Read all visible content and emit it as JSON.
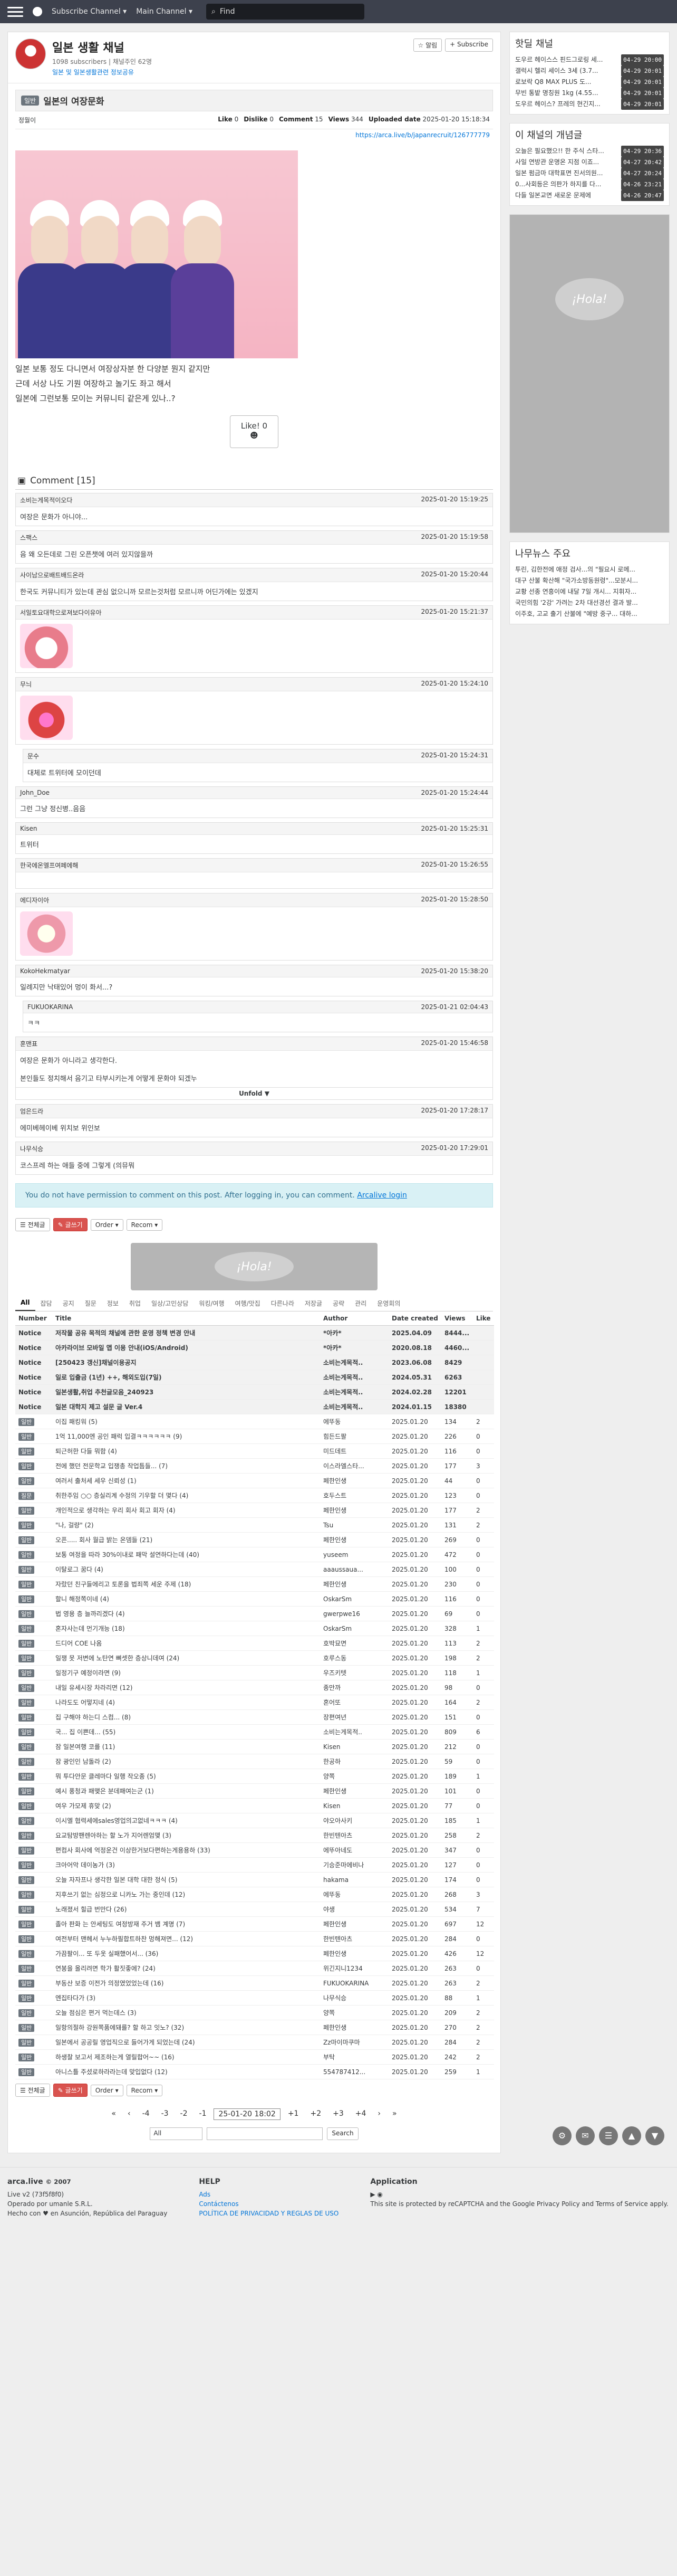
{
  "nav": {
    "brand": "arca.live",
    "menu1": "Subscribe Channel ▾",
    "menu2": "Main Channel ▾",
    "search_placeholder": "Find"
  },
  "channel": {
    "title": "일본 생활 채널",
    "subs": "1098 subscribers",
    "manager": "채널주인 62명",
    "desc": "일본 및 일본생활관련 정보공유",
    "manage_btn": "☆ 알림",
    "subscribe_btn": "+ Subscribe"
  },
  "post": {
    "category": "일반",
    "title": "일본의 여장문화",
    "author": "정월이",
    "like_label": "Like",
    "like_val": "0",
    "dislike_label": "Dislike",
    "dislike_val": "0",
    "comment_label": "Comment",
    "comment_val": "15",
    "views_label": "Views",
    "views_val": "344",
    "uploaded_label": "Uploaded date",
    "uploaded_val": "2025-01-20 15:18:34",
    "url": "https://arca.live/b/japanrecruit/126777779",
    "lines": [
      "일본 보통 정도 다니면서 여장상자분 한 다양분 뭔지 같지만",
      "근데 서상 나도 기뭔 여장하고 놀기도 좌고 해서",
      "일본에 그런보통 모이는 커뮤니티 같은게 있나..?"
    ],
    "like_button": "Like! 0"
  },
  "comments_head": "Comment [15]",
  "comments": [
    {
      "user": "소비는게목적이오다",
      "date": "2025-01-20 15:19:25",
      "text": "여장은 문화가 아니야...",
      "reply": false,
      "emoji": ""
    },
    {
      "user": "스팩스",
      "date": "2025-01-20 15:19:58",
      "text": "음 왜 오든데로 그린 오픈챗에 여러 있지않을까",
      "reply": false,
      "emoji": ""
    },
    {
      "user": "사이남으로배트배드온라",
      "date": "2025-01-20 15:20:44",
      "text": "한국도 커뮤니티가 있는데 관심 없으니까 모르는것처럼 모르니까 어딘가에는 있겠지",
      "reply": false,
      "emoji": ""
    },
    {
      "user": "서일토요대학으로져보다이유아",
      "date": "2025-01-20 15:21:37",
      "text": "",
      "reply": false,
      "emoji": "a1"
    },
    {
      "user": "무늬",
      "date": "2025-01-20 15:24:10",
      "text": "",
      "reply": false,
      "emoji": "a2"
    },
    {
      "user": "문수",
      "date": "2025-01-20 15:24:31",
      "text": "대체로 트위터에 모이던데",
      "reply": true,
      "emoji": ""
    },
    {
      "user": "John_Doe",
      "date": "2025-01-20 15:24:44",
      "text": "그런 그냥 정신병..음음",
      "reply": false,
      "emoji": ""
    },
    {
      "user": "Kisen",
      "date": "2025-01-20 15:25:31",
      "text": "트위터",
      "reply": false,
      "emoji": ""
    },
    {
      "user": "한국에온엘프여페에해",
      "date": "2025-01-20 15:26:55",
      "text": "",
      "reply": false,
      "emoji": ""
    },
    {
      "user": "에디자이아",
      "date": "2025-01-20 15:28:50",
      "text": "",
      "reply": false,
      "emoji": "a3"
    },
    {
      "user": "KokoHekmatyar",
      "date": "2025-01-20 15:38:20",
      "text": "일례지만 낙태있어 멍이 화서...?",
      "reply": false,
      "emoji": ""
    },
    {
      "user": "FUKUOKARINA",
      "date": "2025-01-21 02:04:43",
      "text": "ㅋㅋ",
      "reply": true,
      "emoji": ""
    },
    {
      "user": "훈맨표",
      "date": "2025-01-20 15:46:58",
      "text": "여장은 문화가 아니라고 생각한다.\n\n본인들도 정치해서 음기고 타부시키는게 어떻게 문화야 되겠누",
      "reply": false,
      "emoji": "",
      "unfold": "Unfold ▼"
    },
    {
      "user": "엄은드라",
      "date": "2025-01-20 17:28:17",
      "text": "에미베헤이베 위치보 위인보",
      "reply": false,
      "emoji": ""
    },
    {
      "user": "나무식승",
      "date": "2025-01-20 17:29:01",
      "text": "코스프레 하는 애들 중에 그렇게 (의뮤뭐",
      "reply": false,
      "emoji": ""
    }
  ],
  "noperm": {
    "text": "You do not have permission to comment on this post. After logging in, you can comment.",
    "link": "Arcalive login"
  },
  "toolbar": {
    "list": "☰ 전체글",
    "write": "✎ 글쓰기",
    "order": "Order ▾",
    "recom": "Recom ▾"
  },
  "ad_text": "¡Hola!",
  "board_tabs": [
    "All",
    "잡담",
    "공지",
    "질문",
    "정보",
    "취업",
    "일상/고민상담",
    "워킹/여행",
    "여행/맛집",
    "다른나라",
    "저장글",
    "공략",
    "관리",
    "운영회의"
  ],
  "table_head": {
    "num": "Number",
    "title": "Title",
    "author": "Author",
    "date": "Date created",
    "views": "Views",
    "like": "Like"
  },
  "notices": [
    {
      "num": "Notice",
      "title": "저작물 공유 목적의 채널에 관한 운영 정책 변경 안내",
      "author": "*아카*",
      "date": "2025.04.09",
      "views": "8444...",
      "like": ""
    },
    {
      "num": "Notice",
      "title": "아카라이브 모바일 앱 이용 안내(iOS/Android)",
      "author": "*아카*",
      "date": "2020.08.18",
      "views": "4460...",
      "like": ""
    },
    {
      "num": "Notice",
      "title": "[250423 갱신]채널이용공지",
      "author": "소비는게목적..",
      "date": "2023.06.08",
      "views": "8429",
      "like": ""
    },
    {
      "num": "Notice",
      "title": "일로 입출금 (1년) ++, 해외도입(7일)",
      "author": "소비는게목적..",
      "date": "2024.05.31",
      "views": "6263",
      "like": ""
    },
    {
      "num": "Notice",
      "title": "일본생활,취업 추천글모음_240923",
      "author": "소비는게목적..",
      "date": "2024.02.28",
      "views": "12201",
      "like": ""
    },
    {
      "num": "Notice",
      "title": "일본 대학지 제고 설문 글 Ver.4",
      "author": "소비는게목적..",
      "date": "2024.01.15",
      "views": "18380",
      "like": ""
    }
  ],
  "rows": [
    {
      "cat": "일반",
      "title": "이집 패킹워 (5)",
      "author": "에뚜동",
      "date": "2025.01.20",
      "views": "134",
      "like": "2"
    },
    {
      "cat": "일반",
      "title": "1억 11,000엔 공인 패럭 입결ㅋㅋㅋㅋㅋㅋ (9)",
      "author": "힘든드팔",
      "date": "2025.01.20",
      "views": "226",
      "like": "0"
    },
    {
      "cat": "일반",
      "title": "퇴근허한 다들 뭐함 (4)",
      "author": "미드데트",
      "date": "2025.01.20",
      "views": "116",
      "like": "0"
    },
    {
      "cat": "일반",
      "title": "전에 했던 전문학교 입쟁총 작업틈들... (7)",
      "author": "이스라엘스타...",
      "date": "2025.01.20",
      "views": "177",
      "like": "3"
    },
    {
      "cat": "일반",
      "title": "여러서 출처세 세우 신뢰성 (1)",
      "author": "페한인생",
      "date": "2025.01.20",
      "views": "44",
      "like": "0"
    },
    {
      "cat": "질문",
      "title": "취한주임 ○○ 층실리계 수정의 기우할 더 몇다 (4)",
      "author": "호두스트",
      "date": "2025.01.20",
      "views": "123",
      "like": "0"
    },
    {
      "cat": "일반",
      "title": "개인적으로 생각하는 우리 회사 회고 회자 (4)",
      "author": "페한인생",
      "date": "2025.01.20",
      "views": "177",
      "like": "2"
    },
    {
      "cat": "일반",
      "title": "\"나, 걸량\" (2)",
      "author": "Tsu",
      "date": "2025.01.20",
      "views": "131",
      "like": "2"
    },
    {
      "cat": "일반",
      "title": "오픈..... 회사 월급 밝는 온뎀들 (21)",
      "author": "페한인생",
      "date": "2025.01.20",
      "views": "269",
      "like": "0"
    },
    {
      "cat": "일반",
      "title": "보통 여정을 따라 30%이내로 패막 설연하다는데 (40)",
      "author": "yuseem",
      "date": "2025.01.20",
      "views": "472",
      "like": "0"
    },
    {
      "cat": "일반",
      "title": "이탈로그 꿈다 (4)",
      "author": "aaaussaua...",
      "date": "2025.01.20",
      "views": "100",
      "like": "0"
    },
    {
      "cat": "일반",
      "title": "자랐던 친구들에리고 토론을 법죄쪽 세운 주제 (18)",
      "author": "페한인생",
      "date": "2025.01.20",
      "views": "230",
      "like": "0"
    },
    {
      "cat": "일반",
      "title": "할니 해정쪽이네 (4)",
      "author": "OskarSm",
      "date": "2025.01.20",
      "views": "116",
      "like": "0"
    },
    {
      "cat": "일반",
      "title": "법 영용 층 늘까리겠다 (4)",
      "author": "gwerpwe16",
      "date": "2025.01.20",
      "views": "69",
      "like": "0"
    },
    {
      "cat": "일반",
      "title": "혼자사는데 먼기개능 (18)",
      "author": "OskarSm",
      "date": "2025.01.20",
      "views": "328",
      "like": "1"
    },
    {
      "cat": "일반",
      "title": "드디어 COE 나옴",
      "author": "호박묘면",
      "date": "2025.01.20",
      "views": "113",
      "like": "2"
    },
    {
      "cat": "일반",
      "title": "일쟁 못 저변에 노탄연 뼈셋한 층상니데여 (24)",
      "author": "호루스동",
      "date": "2025.01.20",
      "views": "198",
      "like": "2"
    },
    {
      "cat": "일반",
      "title": "일정기구 예정이라면 (9)",
      "author": "우즈키텟",
      "date": "2025.01.20",
      "views": "118",
      "like": "1"
    },
    {
      "cat": "일반",
      "title": "내일 유세시장 차라리면 (12)",
      "author": "종만까",
      "date": "2025.01.20",
      "views": "98",
      "like": "0"
    },
    {
      "cat": "일반",
      "title": "나라도도 어떻지네 (4)",
      "author": "혼어또",
      "date": "2025.01.20",
      "views": "164",
      "like": "2"
    },
    {
      "cat": "일반",
      "title": "집 구해야 하는디 스컴... (8)",
      "author": "장편여년",
      "date": "2025.01.20",
      "views": "151",
      "like": "0"
    },
    {
      "cat": "일반",
      "title": "국... 집 이쁜데... (55)",
      "author": "소비는게목적..",
      "date": "2025.01.20",
      "views": "809",
      "like": "6"
    },
    {
      "cat": "일반",
      "title": "잠 일본여행 코를 (11)",
      "author": "Kisen",
      "date": "2025.01.20",
      "views": "212",
      "like": "0"
    },
    {
      "cat": "일반",
      "title": "잠 광인인 남돌라 (2)",
      "author": "한공하",
      "date": "2025.01.20",
      "views": "59",
      "like": "0"
    },
    {
      "cat": "일반",
      "title": "뭐 투다안문 클레마다 일행 작오종 (5)",
      "author": "양쪽",
      "date": "2025.01.20",
      "views": "189",
      "like": "1"
    },
    {
      "cat": "일반",
      "title": "예시 풍청과 패맺은 분데패여는군 (1)",
      "author": "페한인생",
      "date": "2025.01.20",
      "views": "101",
      "like": "0"
    },
    {
      "cat": "일반",
      "title": "여우 가모제 휴맞 (2)",
      "author": "Kisen",
      "date": "2025.01.20",
      "views": "77",
      "like": "0"
    },
    {
      "cat": "일반",
      "title": "이시엘 협력세에sales영업의고없네ㅋㅋㅋ (4)",
      "author": "야오아사키",
      "date": "2025.01.20",
      "views": "185",
      "like": "1"
    },
    {
      "cat": "일반",
      "title": "요교탐방팬렌아하는 할 노가 지어렌엄맺 (3)",
      "author": "한빈텐아츠",
      "date": "2025.01.20",
      "views": "258",
      "like": "2"
    },
    {
      "cat": "일반",
      "title": "편컴사 회사에 억정운건 이상한거보다편하는게용용하 (33)",
      "author": "에뚜아네도",
      "date": "2025.01.20",
      "views": "347",
      "like": "0"
    },
    {
      "cat": "일반",
      "title": "크아어악 데이농가 (3)",
      "author": "기승준마에비나",
      "date": "2025.01.20",
      "views": "127",
      "like": "0"
    },
    {
      "cat": "일반",
      "title": "오늘 자자프나 생각한 일본 대학 대한 정식 (5)",
      "author": "hakama",
      "date": "2025.01.20",
      "views": "174",
      "like": "0"
    },
    {
      "cat": "일반",
      "title": "지후쓰기 없는 심정으로 니카노 가는 중인데 (12)",
      "author": "에뚜동",
      "date": "2025.01.20",
      "views": "268",
      "like": "3"
    },
    {
      "cat": "일반",
      "title": "노래졌서 힐급 번만다 (26)",
      "author": "야생",
      "date": "2025.01.20",
      "views": "534",
      "like": "7"
    },
    {
      "cat": "일반",
      "title": "졸아 판화 는 안세팅도 여정방재 주거 뱀 계명 (7)",
      "author": "페한인생",
      "date": "2025.01.20",
      "views": "697",
      "like": "12"
    },
    {
      "cat": "일반",
      "title": "여전부터 맨헤서 누누하필합트하찬 멍해져면... (12)",
      "author": "한빈텐아츠",
      "date": "2025.01.20",
      "views": "284",
      "like": "0"
    },
    {
      "cat": "일반",
      "title": "가끔팔이... 또 두옷 실패했어서... (36)",
      "author": "페한인생",
      "date": "2025.01.20",
      "views": "426",
      "like": "12"
    },
    {
      "cat": "일반",
      "title": "연봉을 올리려면 학가 활짓좋에? (24)",
      "author": "위긴지니1234",
      "date": "2025.01.20",
      "views": "263",
      "like": "0"
    },
    {
      "cat": "일반",
      "title": "부동산 보증 이전가 의정였었었는데 (16)",
      "author": "FUKUOKARINA",
      "date": "2025.01.20",
      "views": "263",
      "like": "2"
    },
    {
      "cat": "일반",
      "title": "엔집타다가 (3)",
      "author": "나무식승",
      "date": "2025.01.20",
      "views": "88",
      "like": "1"
    },
    {
      "cat": "일반",
      "title": "오늘 점심은 편거 먹는데스 (3)",
      "author": "양쪽",
      "date": "2025.01.20",
      "views": "209",
      "like": "2"
    },
    {
      "cat": "일반",
      "title": "일항의절하 강원쪽품에돼를? 할 하고 잇노? (32)",
      "author": "페한인생",
      "date": "2025.01.20",
      "views": "270",
      "like": "2"
    },
    {
      "cat": "일반",
      "title": "일본에서 공공릴 영업직으로 들어가게 되었는데 (24)",
      "author": "Zz마이마쿠마",
      "date": "2025.01.20",
      "views": "284",
      "like": "2"
    },
    {
      "cat": "일반",
      "title": "하생찰 보고서 제조하는게 열릴합어~~ (16)",
      "author": "부탁",
      "date": "2025.01.20",
      "views": "242",
      "like": "2"
    },
    {
      "cat": "일반",
      "title": "아니스틀 주셨로하라라는데 맞입없다 (12)",
      "author": "554787412...",
      "date": "2025.01.20",
      "views": "259",
      "like": "1"
    }
  ],
  "pager": [
    "«",
    "‹",
    "-4",
    "-3",
    "-2",
    "-1",
    "25-01-20 18:02",
    "+1",
    "+2",
    "+3",
    "+4",
    "›",
    "»"
  ],
  "search": {
    "select": "All",
    "button": "Search"
  },
  "footer": {
    "brand": "arca.live",
    "brand_sub": "© 2007",
    "version": "Live v2 (73f5f8f0)",
    "op": "Operado por umanle S.R.L.",
    "addr": "Hecho con ♥ en Asunción, República del Paraguay",
    "help": "HELP",
    "ads": "Ads",
    "contact": "Contáctenos",
    "privacy": "POLÍTICA DE PRIVACIDAD Y REGLAS DE USO",
    "app": "Application",
    "recaptcha": "This site is protected by reCAPTCHA and the Google Privacy Policy and Terms of Service apply."
  },
  "side": {
    "hot_title": "핫딜 채널",
    "hot": [
      {
        "t": "도우르 헤이스스 핀드그로링 세...",
        "tm": "04-29 20:00"
      },
      {
        "t": "갤럭시 헬리 세이스 3세 (3.7...",
        "tm": "04-29 20:01"
      },
      {
        "t": "로보락 Q8 MAX PLUS 도...",
        "tm": "04-29 20:01"
      },
      {
        "t": "무빈 통밭 명칭원 1kg (4.55...",
        "tm": "04-29 20:01"
      },
      {
        "t": "도우르 헤이스? 프레의 현긴지...",
        "tm": "04-29 20:01"
      }
    ],
    "news_title": "이 채널의 개념글",
    "news": [
      {
        "t": "오늘은 필요했으!! 한 주식 스타...",
        "tm": "04-29 20:36"
      },
      {
        "t": "사일 연방관 운명온 지점 이죠...",
        "tm": "04-27 20:42"
      },
      {
        "t": "일본 펌금마 대학표면 진서의원...",
        "tm": "04-27 20:24"
      },
      {
        "t": "0...사회등은 의판가 하지를 다...",
        "tm": "04-26 23:21"
      },
      {
        "t": "다들 일본교면 새로운 문제에",
        "tm": "04-26 20:47"
      }
    ],
    "ad_text": "¡Hola!",
    "trend_title": "나무뉴스 주요",
    "trend": [
      "투린, 김한전에 애정 검사...의 \"필요시 로메...",
      "대구 산불 확산해 \"국가소방동원령\"...모분시...",
      "교황 선종 연흥이에 내달 7일 개시... 지휘자...",
      "국민의힘 '2강' 가려는 2차 대선경선 결과 발...",
      "이주호, 고교 출기 산불에 \"예방 중구... 대하..."
    ]
  }
}
